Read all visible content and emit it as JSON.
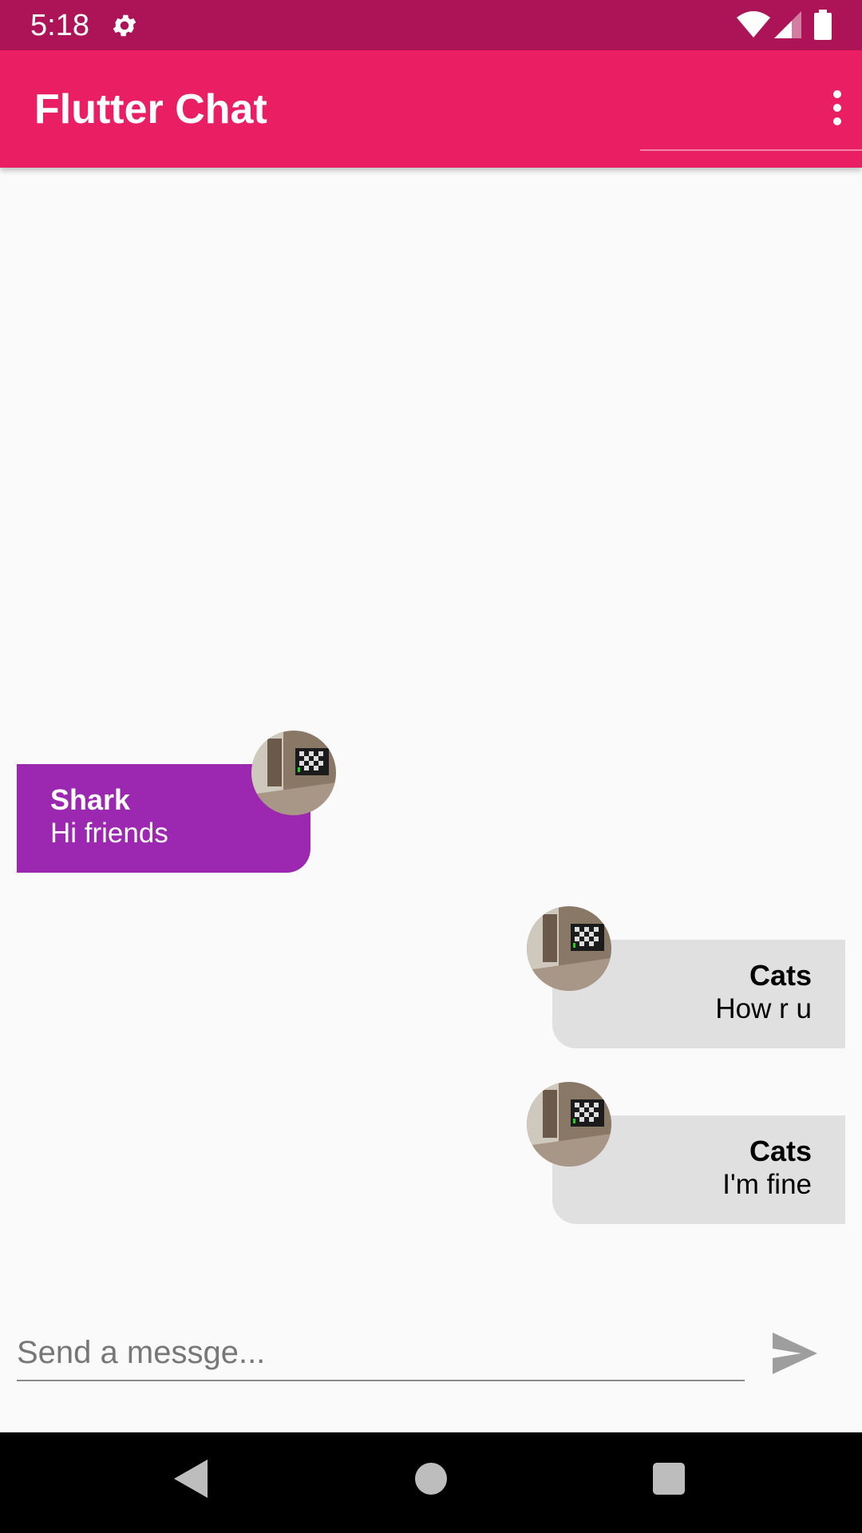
{
  "status_bar": {
    "time": "5:18",
    "icons": [
      "gear-icon",
      "wifi-icon",
      "signal-icon",
      "battery-icon"
    ]
  },
  "app_bar": {
    "title": "Flutter Chat",
    "menu_icon": "more-vert-icon",
    "color": "#e91e63",
    "status_color": "#ad1457"
  },
  "messages": [
    {
      "sender": "Shark",
      "text": "Hi friends",
      "side": "left",
      "bubble_color": "#9c27b0"
    },
    {
      "sender": "Cats",
      "text": "How r u",
      "side": "right",
      "bubble_color": "#e0e0e0"
    },
    {
      "sender": "Cats",
      "text": "I'm fine",
      "side": "right",
      "bubble_color": "#e0e0e0"
    }
  ],
  "composer": {
    "placeholder": "Send a messge...",
    "value": "",
    "send_icon": "send-icon"
  },
  "nav_bar": {
    "icons": [
      "back-icon",
      "home-icon",
      "recents-icon"
    ]
  }
}
